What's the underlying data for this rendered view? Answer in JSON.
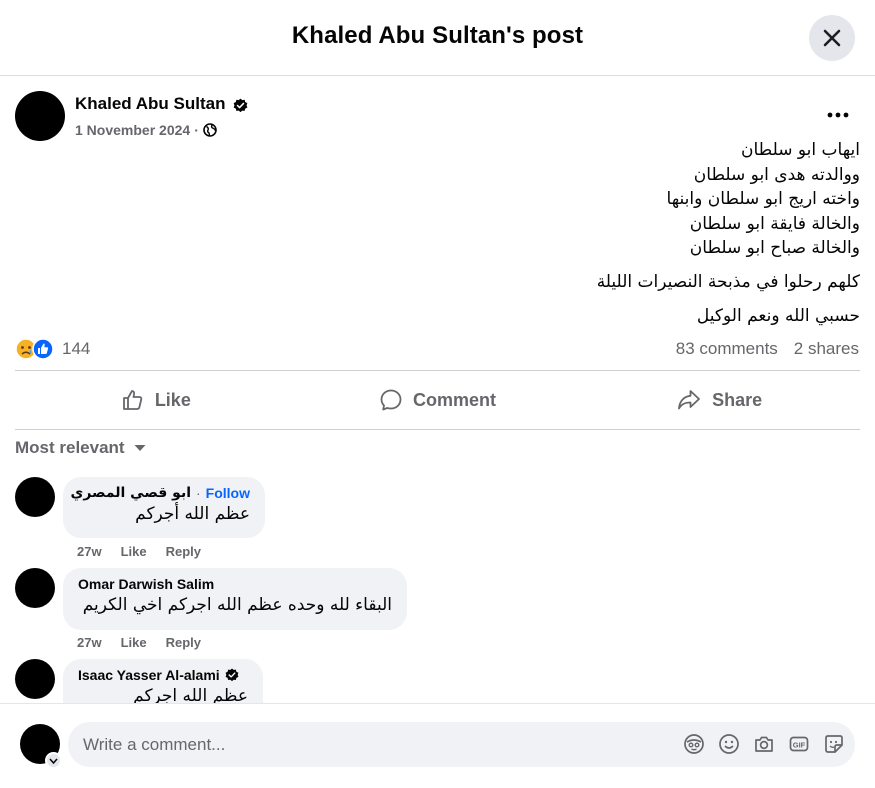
{
  "header": {
    "title": "Khaled Abu Sultan's post"
  },
  "post": {
    "author": "Khaled Abu Sultan",
    "date": "1 November 2024",
    "date_separator": "·",
    "lines": [
      "ايهاب ابو سلطان",
      "ووالدته هدى ابو سلطان",
      "واخته اريج ابو سلطان وابنها",
      "والخالة فايقة ابو سلطان",
      "والخالة صباح ابو سلطان"
    ],
    "paragraph2": "كلهم رحلوا في مذبحة النصيرات الليلة",
    "paragraph3": "حسبي الله ونعم الوكيل",
    "reaction_count": "144",
    "comments_count": "83 comments",
    "shares_count": "2 shares"
  },
  "actions": {
    "like": "Like",
    "comment": "Comment",
    "share": "Share"
  },
  "sort_label": "Most relevant",
  "comments": [
    {
      "name": "ابو قصي المصري",
      "separator": "·",
      "follow": "Follow",
      "text": "عظم الله أجركم",
      "time": "27w",
      "like": "Like",
      "reply": "Reply"
    },
    {
      "name": "Omar Darwish Salim",
      "text": "البقاء لله وحده عظم الله اجركم اخي الكريم",
      "time": "27w",
      "like": "Like",
      "reply": "Reply"
    },
    {
      "name": "Isaac Yasser Al-alami",
      "text": "عظم الله اجركم"
    }
  ],
  "composer": {
    "placeholder": "Write a comment..."
  },
  "colors": {
    "accent": "#0866ff",
    "secondary_text": "#65676b",
    "bubble": "#f0f2f5",
    "divider": "#ced0d4"
  },
  "icons": [
    "close-icon",
    "verified-icon",
    "globe-icon",
    "more-icon",
    "like-icon",
    "comment-icon",
    "share-icon",
    "chevron-down-icon",
    "avatar-icon",
    "emoji-icon",
    "camera-icon",
    "gif-icon",
    "sticker-icon"
  ]
}
